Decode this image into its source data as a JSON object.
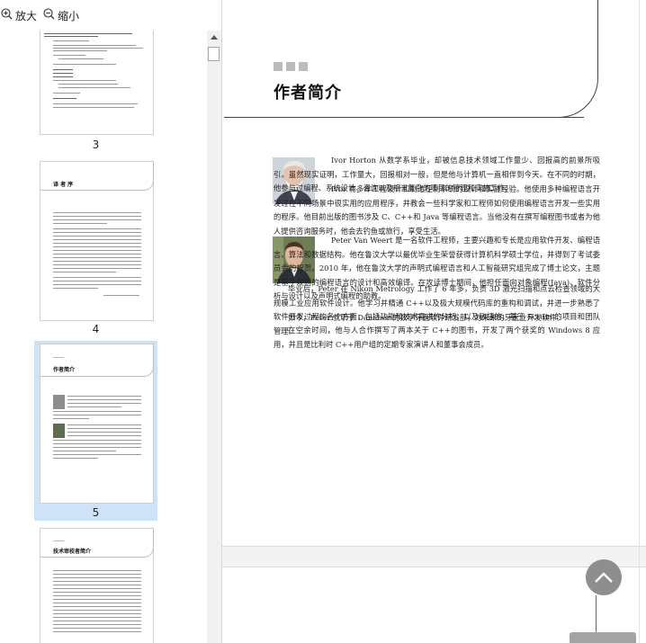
{
  "toolbar": {
    "zoom_in_label": "放大",
    "zoom_out_label": "缩小"
  },
  "thumbnails": {
    "pages": [
      {
        "number": "3"
      },
      {
        "number": "4",
        "title": "译 者 序"
      },
      {
        "number": "5",
        "title": "作者简介",
        "selected": true
      },
      {
        "number": "",
        "title": "技术审校者简介"
      }
    ]
  },
  "document": {
    "title": "作者简介",
    "paragraphs": [
      "Ivor Horton 从数学系毕业，却被信息技术领域工作量少、回报高的前景所吸引。虽然现实证明，工作量大，回报相对一般，但是他与计算机一直相伴到今天。在不同的时期，他参与过编程、系统设计、咨询以及相当复杂的项目的管理和实施工作。",
      "Ivor 有多年工程设计和制造控制系统的设计和实施经验。他使用多种编程语言开发过在不同场景中很实用的应用程序，并教会一些科学家和工程师如何使用编程语言开发一些实用的程序。他目前出版的图书涉及 C、C++和 Java 等编程语言。当他没有在撰写编程图书或者为他人提供咨询服务时，他会去钓鱼或旅行，享受生活。",
      "Peter Van Weert 是一名软件工程师，主要兴趣和专长是应用软件开发、编程语言、算法和数据结构。他在鲁汶大学以最优毕业生荣誉获得计算机科学硕士学位，并得到了考试委员会的祝贺。2010 年，他在鲁汶大学的声明式编程语言和人工智能研究组完成了博士论文，主题是基于规则的编程语言的设计和高效编译。在攻读博士期间，他担任面向对象编程(Java)、软件分析与设计以及声明式编程的助教。",
      "毕业后，Peter 在 Nikon Metrology 工作了 6 年多，负责 3D 激光扫描和点云检查领域的大规模工业应用软件设计。他学习并精通 C++以及极大规模代码库的重构和调试，并进一步熟悉了软件开发过程的各个方面，包括功能和技术需求的分析，以及敏捷的、基于 Scrum 的项目和团队管理。",
      "如今，Peter 就职于 Danaher 的数字牙医软件研发部，为未来的牙医业开发软件。",
      "在空余时间，他与人合作撰写了两本关于 C++的图书，开发了两个获奖的 Windows 8 应用，并且是比利时 C++用户组的定期专家演讲人和董事会成员。"
    ]
  }
}
